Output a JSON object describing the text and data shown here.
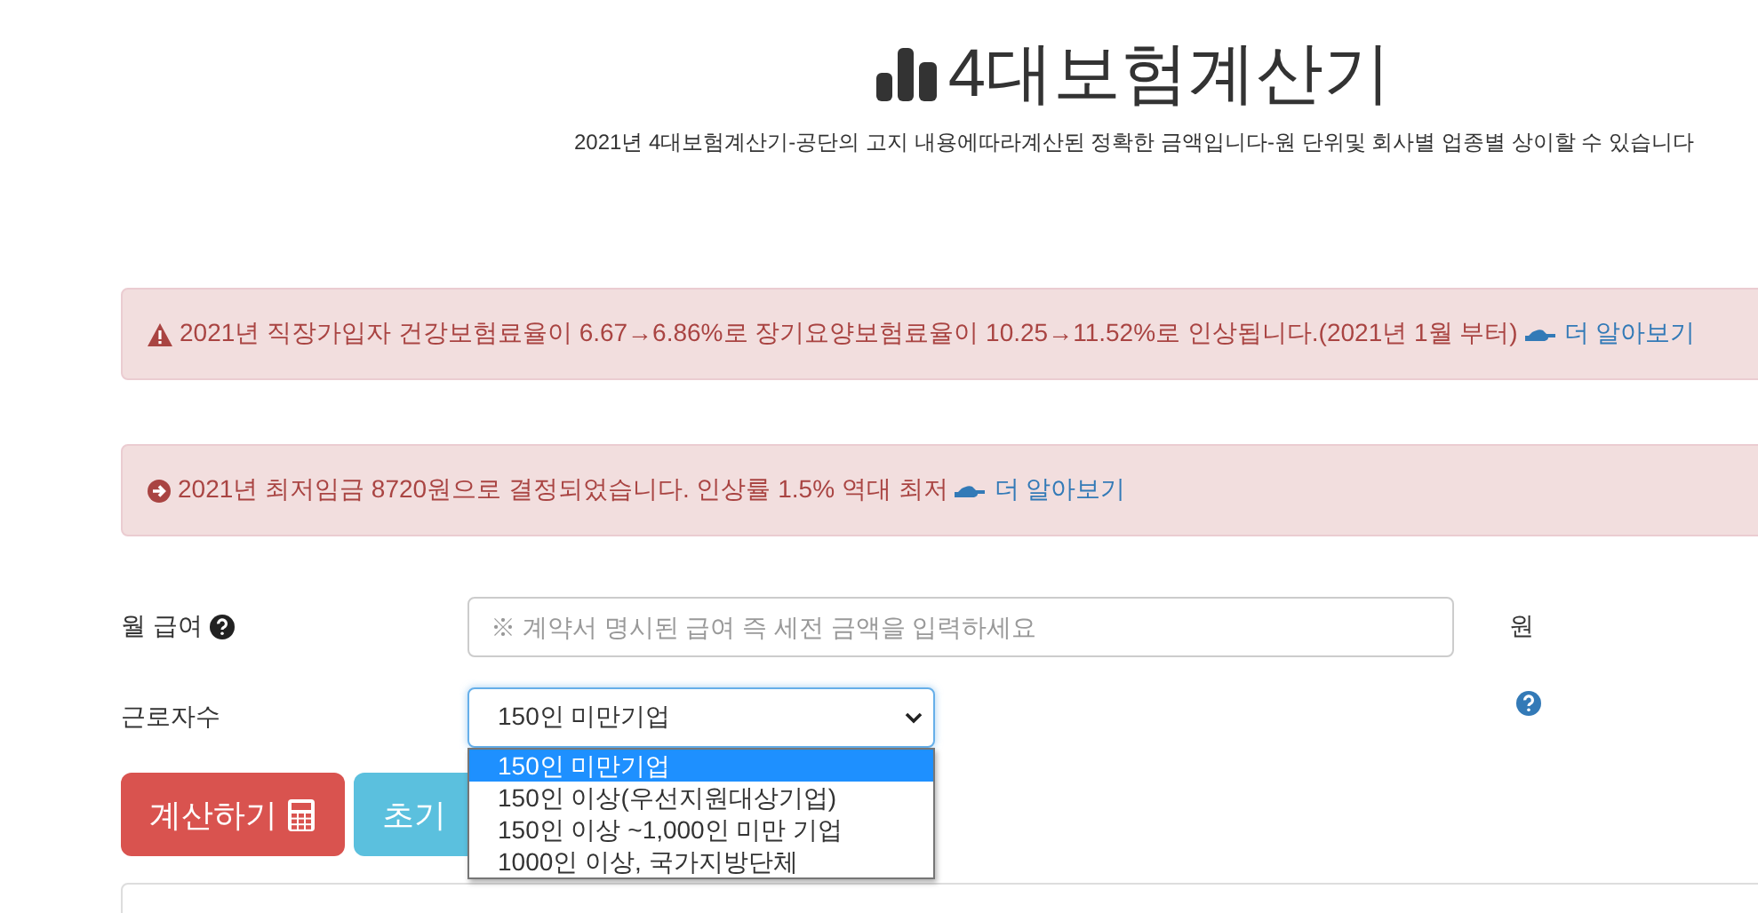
{
  "header": {
    "title": "4대보험계산기",
    "subtitle": "2021년 4대보험계산기-공단의 고지 내용에따라계산된 정확한 금액입니다-원 단위및 회사별 업종별 상이할 수 있습니다"
  },
  "alerts": [
    {
      "kind": "warning",
      "text": "2021년 직장가입자 건강보험료율이 6.67→6.86%로 장기요양보험료율이 10.25→11.52%로 인상됩니다.(2021년 1월 부터)",
      "link": "더 알아보기"
    },
    {
      "kind": "info",
      "text": "2021년 최저임금 8720원으로 결정되었습니다. 인상률 1.5% 역대 최저",
      "link": "더 알아보기"
    }
  ],
  "salary": {
    "label": "월 급여",
    "placeholder": "※ 계약서 명시된 급여 즉 세전 금액을 입력하세요",
    "unit": "원"
  },
  "workers": {
    "label": "근로자수",
    "value": "150인 미만기업",
    "expanded": true,
    "options": [
      {
        "label": "150인 미만기업",
        "selected": true
      },
      {
        "label": "150인 이상(우선지원대상기업)",
        "selected": false
      },
      {
        "label": "150인 이상 ~1,000인 미만 기업",
        "selected": false
      },
      {
        "label": "1000인 이상, 국가지방단체",
        "selected": false
      }
    ]
  },
  "buttons": [
    {
      "kind": "calculate",
      "label": "계산하기"
    },
    {
      "kind": "reset",
      "label": "초기"
    }
  ]
}
